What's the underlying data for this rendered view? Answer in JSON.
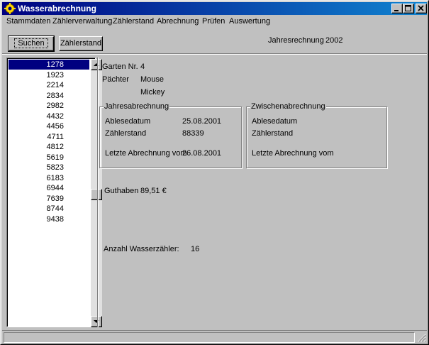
{
  "window": {
    "title": "Wasserabrechnung"
  },
  "menu": [
    "Stammdaten",
    "Zählerverwaltung",
    "Zählerstand",
    "Abrechnung",
    "Prüfen",
    "Auswertung"
  ],
  "toolbar": {
    "search_label": "Suchen",
    "meter_label": "Zählerstand",
    "year_label": "Jahresrechnung",
    "year_value": "2002"
  },
  "list": {
    "items": [
      "1278",
      "1923",
      "2214",
      "2834",
      "2982",
      "4432",
      "4456",
      "4711",
      "4812",
      "5619",
      "5823",
      "6183",
      "6944",
      "7639",
      "8744",
      "9438"
    ],
    "selected_index": 0
  },
  "detail": {
    "garden_label": "Garten Nr.",
    "garden_value": "4",
    "tenant_label": "Pächter",
    "tenant_last": "Mouse",
    "tenant_first": "Mickey"
  },
  "annual": {
    "title": "Jahresabrechnung",
    "reading_date_label": "Ablesedatum",
    "reading_date_value": "25.08.2001",
    "meter_label": "Zählerstand",
    "meter_value": "88339",
    "last_bill_label": "Letzte Abrechnung vom",
    "last_bill_value": "26.08.2001"
  },
  "interim": {
    "title": "Zwischenabrechnung",
    "reading_date_label": "Ablesedatum",
    "meter_label": "Zählerstand",
    "last_bill_label": "Letzte Abrechnung vom"
  },
  "credit": {
    "label": "Guthaben",
    "value": "89,51 €"
  },
  "meters": {
    "label": "Anzahl Wasserzähler:",
    "value": "16"
  },
  "colors": {
    "titlebar": "#000080",
    "face": "#c0c0c0",
    "selection": "#000080"
  }
}
